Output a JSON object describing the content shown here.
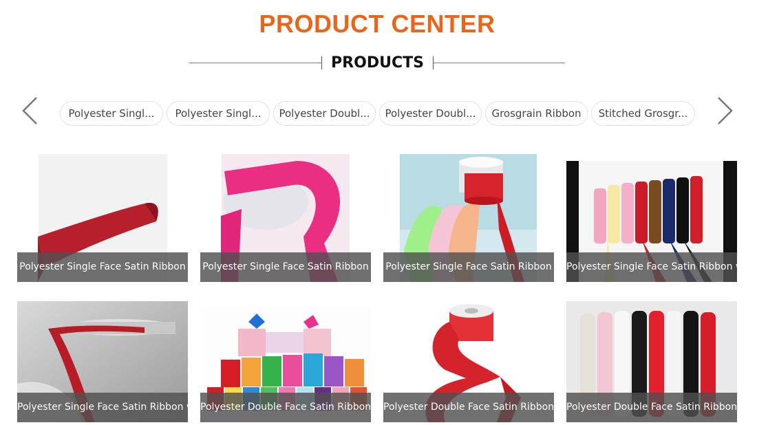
{
  "header": {
    "title": "PRODUCT CENTER",
    "subtitle": "PRODUCTS"
  },
  "carousel": {
    "prev_icon": "chevron-left-icon",
    "next_icon": "chevron-right-icon",
    "categories": [
      "Polyester Singl...",
      "Polyester Singl...",
      "Polyester Doubl...",
      "Polyester Doubl...",
      "Grosgrain Ribbon",
      "Stitched Grosgr..."
    ]
  },
  "products": [
    {
      "name": "Polyester Single Face Satin Ribbon"
    },
    {
      "name": "Polyester Single Face Satin Ribbon"
    },
    {
      "name": "Polyester Single Face Satin Ribbon"
    },
    {
      "name": "Polyester Single Face Satin Ribbon with"
    },
    {
      "name": "Polyester Single Face Satin Ribbon with"
    },
    {
      "name": "Polyester Double Face Satin Ribbon"
    },
    {
      "name": "Polyester Double Face Satin Ribbon"
    },
    {
      "name": "Polyester Double Face Satin Ribbon wit"
    }
  ],
  "colors": {
    "title": "#e8661c",
    "caption_bg": "#505050"
  }
}
